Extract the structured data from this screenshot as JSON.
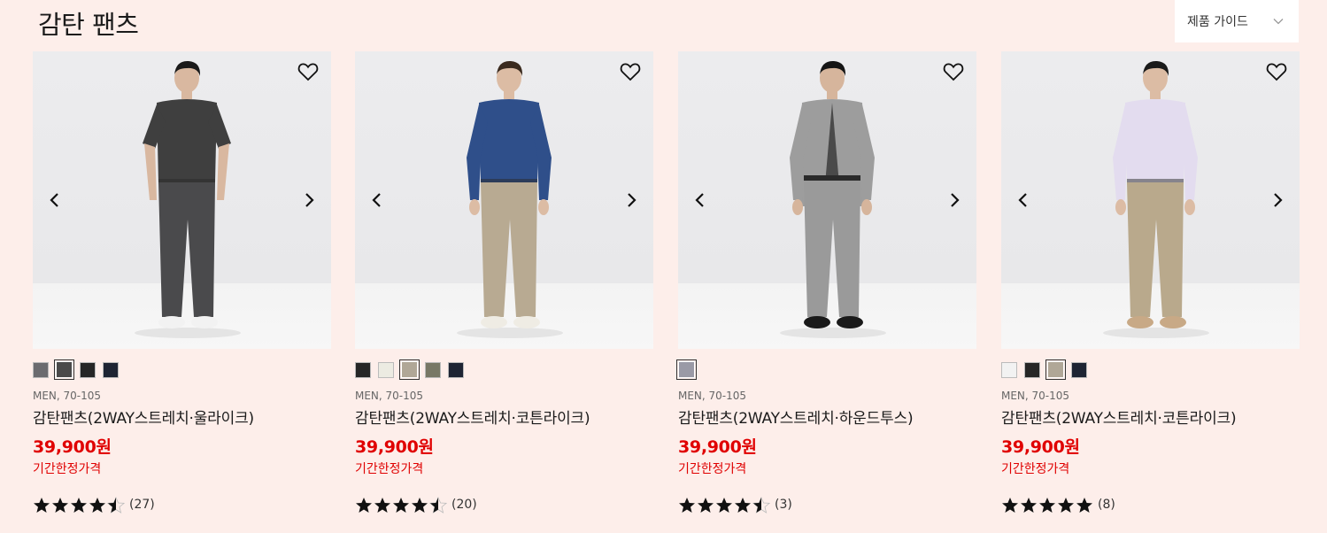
{
  "page": {
    "title": "감탄 팬츠",
    "guide_label": "제품 가이드"
  },
  "products": [
    {
      "category": "MEN, 70-105",
      "name": "감탄팬츠(2WAY스트레치·울라이크)",
      "price": "39,900원",
      "promo": "기간한정가격",
      "rating": 4.5,
      "review_count": "(27)",
      "swatches": [
        "#6b6b6f",
        "#4a4a4a",
        "#262626",
        "#1e2433"
      ],
      "selected_swatch": 1,
      "outfit": {
        "top": "#3f3f3f",
        "pants": "#4a4a4c",
        "shoes": "#f2f2f2",
        "skin": "#d9b8a0",
        "hair": "#1a1a1a"
      }
    },
    {
      "category": "MEN, 70-105",
      "name": "감탄팬츠(2WAY스트레치·코튼라이크)",
      "price": "39,900원",
      "promo": "기간한정가격",
      "rating": 4.5,
      "review_count": "(20)",
      "swatches": [
        "#262626",
        "#ecebe2",
        "#b0a797",
        "#787866",
        "#1e2433"
      ],
      "selected_swatch": 2,
      "outfit": {
        "top": "#2f4f8a",
        "pants": "#b8aa92",
        "shoes": "#efece4",
        "skin": "#dcbca4",
        "hair": "#3a2a1e"
      }
    },
    {
      "category": "MEN, 70-105",
      "name": "감탄팬츠(2WAY스트레치·하운드투스)",
      "price": "39,900원",
      "promo": "기간한정가격",
      "rating": 4.5,
      "review_count": "(3)",
      "swatches": [
        "#9a9aa6"
      ],
      "selected_swatch": 0,
      "outfit": {
        "top": "#9d9d9d",
        "pants": "#9a9a9a",
        "shoes": "#1a1a1a",
        "skin": "#d6b59c",
        "hair": "#151515"
      }
    },
    {
      "category": "MEN, 70-105",
      "name": "감탄팬츠(2WAY스트레치·코튼라이크)",
      "price": "39,900원",
      "promo": "기간한정가격",
      "rating": 5,
      "review_count": "(8)",
      "swatches": [
        "#f2f2f2",
        "#262626",
        "#b0a797",
        "#1e2433"
      ],
      "selected_swatch": 2,
      "outfit": {
        "top": "#e3dcef",
        "pants": "#b9a98c",
        "shoes": "#c8a986",
        "skin": "#dcbca4",
        "hair": "#1a1a1a"
      }
    }
  ]
}
